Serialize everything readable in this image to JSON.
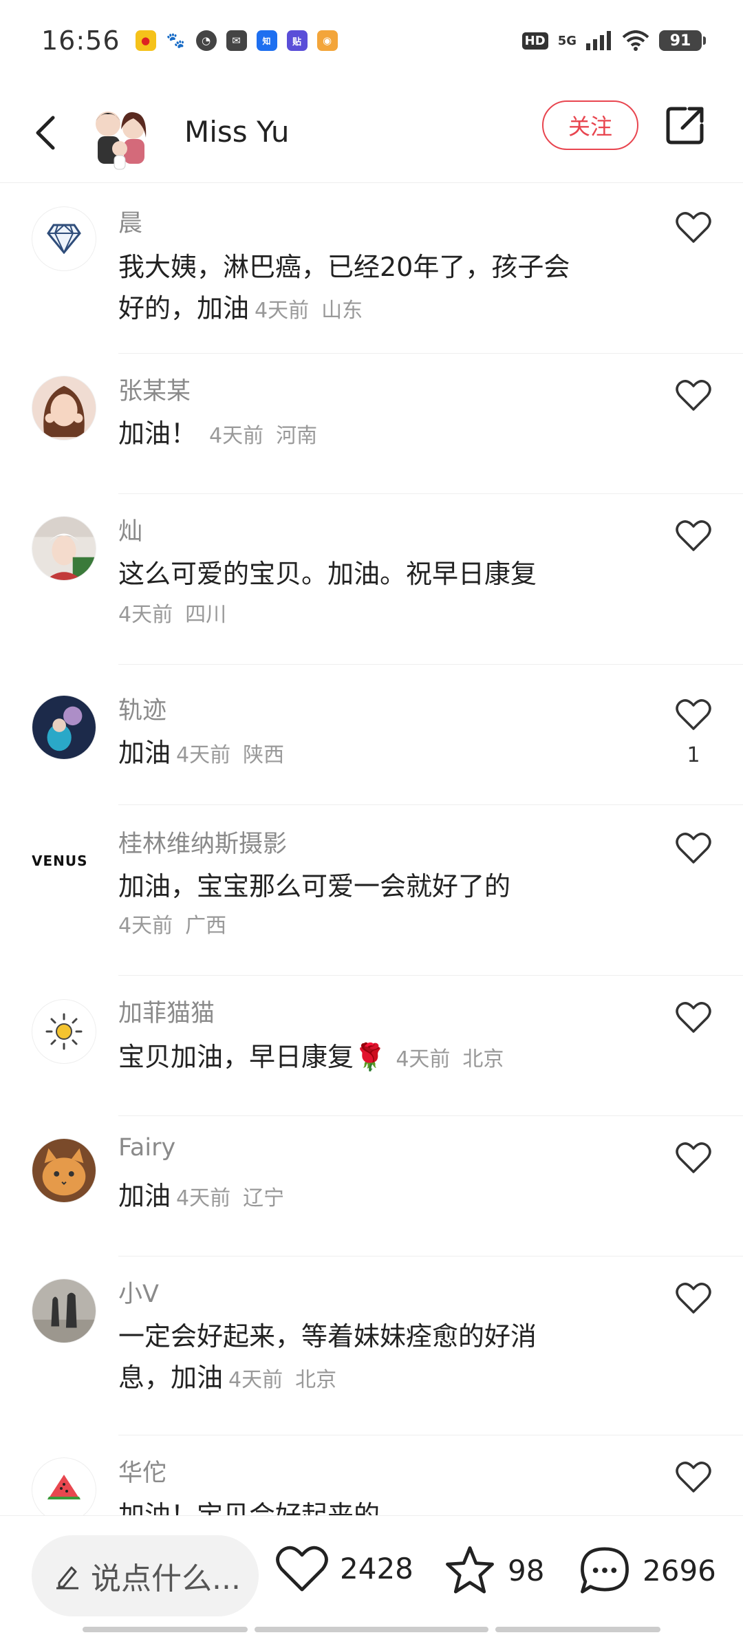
{
  "status_bar": {
    "time": "16:56",
    "hd": "HD",
    "network": "5G",
    "battery": "91",
    "app_icons": [
      "weibo-icon",
      "baidu-icon",
      "game-icon",
      "mail-icon",
      "zhihu-icon",
      "tieba-icon",
      "toutiao-icon"
    ]
  },
  "header": {
    "author_name": "Miss Yu",
    "follow_label": "关注"
  },
  "comments": [
    {
      "user": "晨",
      "line1": "我大姨，淋巴癌，已经20年了，孩子会",
      "line2": "好的，加油",
      "time": "4天前",
      "location": "山东",
      "likes": ""
    },
    {
      "user": "张某某",
      "line1": "加油！",
      "time": "4天前",
      "location": "河南",
      "likes": ""
    },
    {
      "user": "灿",
      "line1": "这么可爱的宝贝。加油。祝早日康复",
      "time": "4天前",
      "location": "四川",
      "likes": ""
    },
    {
      "user": "轨迹",
      "line1": "加油",
      "time": "4天前",
      "location": "陕西",
      "likes": "1"
    },
    {
      "user": "桂林维纳斯摄影",
      "line1": "加油，宝宝那么可爱一会就好了的",
      "time": "4天前",
      "location": "广西",
      "likes": "",
      "avatar_text": "VENUS"
    },
    {
      "user": "加菲猫猫",
      "line1": "宝贝加油，早日康复🌹",
      "time": "4天前",
      "location": "北京",
      "likes": ""
    },
    {
      "user": "Fairy",
      "line1": "加油",
      "time": "4天前",
      "location": "辽宁",
      "likes": ""
    },
    {
      "user": "小V",
      "line1": "一定会好起来，等着妹妹痊愈的好消",
      "line2": "息，加油",
      "time": "4天前",
      "location": "北京",
      "likes": ""
    },
    {
      "user": "华佗",
      "line1": "加油！宝贝会好起来的",
      "time": "",
      "location": "",
      "likes": ""
    }
  ],
  "bottom_bar": {
    "input_placeholder": "说点什么...",
    "like_count": "2428",
    "favorite_count": "98",
    "comment_count": "2696"
  },
  "colors": {
    "accent": "#e8454f",
    "secondary_text": "#8a8a8a",
    "meta_text": "#999999"
  }
}
